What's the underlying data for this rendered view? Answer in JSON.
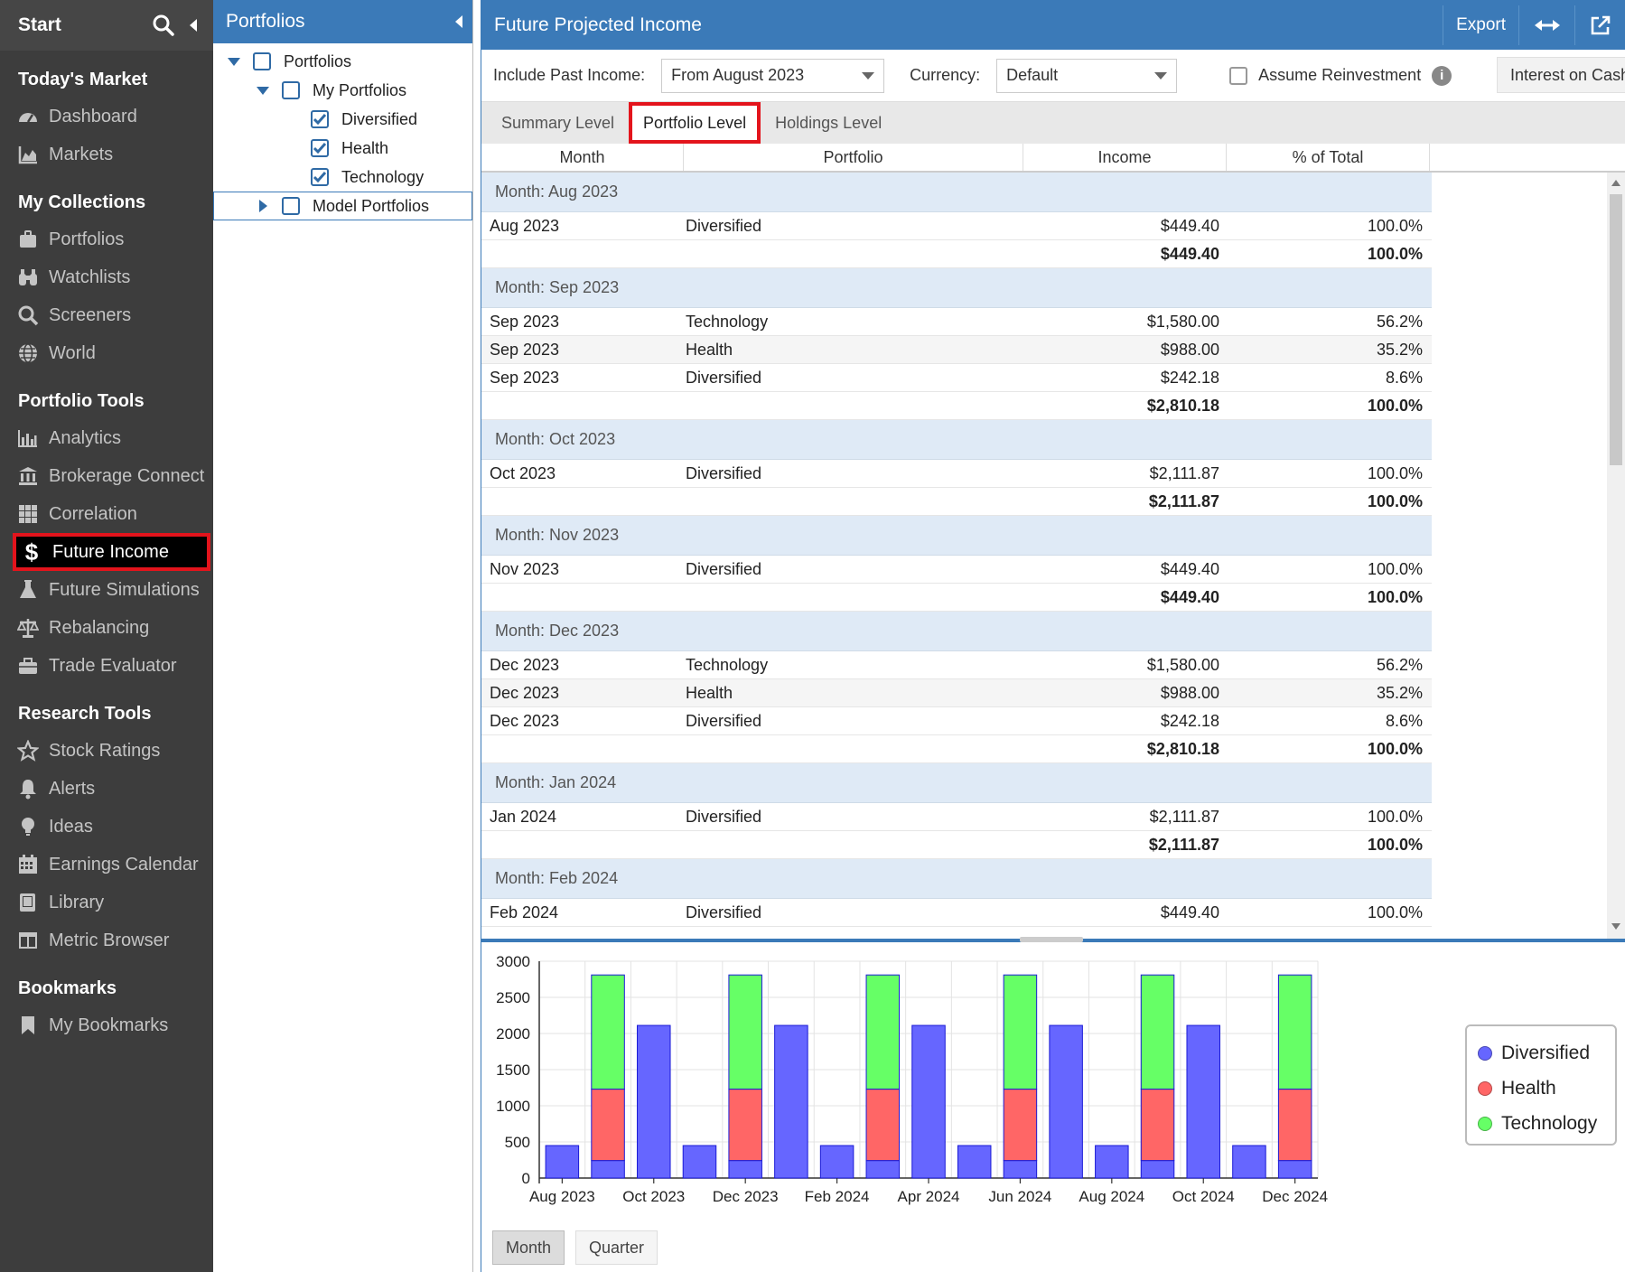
{
  "nav": {
    "start_label": "Start",
    "sections": [
      {
        "title": "Today's Market",
        "items": [
          {
            "label": "Dashboard",
            "icon": "dashboard-icon"
          },
          {
            "label": "Markets",
            "icon": "area-chart-icon"
          }
        ]
      },
      {
        "title": "My Collections",
        "items": [
          {
            "label": "Portfolios",
            "icon": "briefcase-icon"
          },
          {
            "label": "Watchlists",
            "icon": "binoculars-icon"
          },
          {
            "label": "Screeners",
            "icon": "search-icon"
          },
          {
            "label": "World",
            "icon": "globe-icon"
          }
        ]
      },
      {
        "title": "Portfolio Tools",
        "items": [
          {
            "label": "Analytics",
            "icon": "bar-chart-icon"
          },
          {
            "label": "Brokerage Connect",
            "icon": "bank-icon"
          },
          {
            "label": "Correlation",
            "icon": "grid-icon"
          },
          {
            "label": "Future Income",
            "icon": "dollar-icon",
            "active": true
          },
          {
            "label": "Future Simulations",
            "icon": "flask-icon"
          },
          {
            "label": "Rebalancing",
            "icon": "scale-icon"
          },
          {
            "label": "Trade Evaluator",
            "icon": "toolbox-icon"
          }
        ]
      },
      {
        "title": "Research Tools",
        "items": [
          {
            "label": "Stock Ratings",
            "icon": "star-icon"
          },
          {
            "label": "Alerts",
            "icon": "bell-icon"
          },
          {
            "label": "Ideas",
            "icon": "lightbulb-icon"
          },
          {
            "label": "Earnings Calendar",
            "icon": "calendar-icon"
          },
          {
            "label": "Library",
            "icon": "book-icon"
          },
          {
            "label": "Metric Browser",
            "icon": "table-icon"
          }
        ]
      },
      {
        "title": "Bookmarks",
        "items": [
          {
            "label": "My Bookmarks",
            "icon": "bookmark-icon"
          }
        ]
      }
    ]
  },
  "tree": {
    "title": "Portfolios",
    "rows": [
      {
        "label": "Portfolios",
        "level": 0,
        "toggle": "expanded",
        "checked": false
      },
      {
        "label": "My Portfolios",
        "level": 1,
        "toggle": "expanded",
        "checked": false
      },
      {
        "label": "Diversified",
        "level": 2,
        "toggle": "none",
        "checked": true
      },
      {
        "label": "Health",
        "level": 2,
        "toggle": "none",
        "checked": true
      },
      {
        "label": "Technology",
        "level": 2,
        "toggle": "none",
        "checked": true
      },
      {
        "label": "Model Portfolios",
        "level": 1,
        "toggle": "collapsed",
        "checked": false,
        "selected": true
      }
    ]
  },
  "main": {
    "title": "Future Projected Income",
    "export_label": "Export",
    "past_income_label": "Include Past Income:",
    "past_income_value": "From August 2023",
    "currency_label": "Currency:",
    "currency_value": "Default",
    "reinvest_label": "Assume Reinvestment",
    "interest_label": "Interest on Cash",
    "tabs": [
      "Summary Level",
      "Portfolio Level",
      "Holdings Level"
    ],
    "active_tab": 1,
    "columns": [
      "Month",
      "Portfolio",
      "Income",
      "% of Total"
    ],
    "groups": [
      {
        "header": "Month: Aug 2023",
        "rows": [
          [
            "Aug 2023",
            "Diversified",
            "$449.40",
            "100.0%"
          ]
        ],
        "total": [
          "$449.40",
          "100.0%"
        ]
      },
      {
        "header": "Month: Sep 2023",
        "rows": [
          [
            "Sep 2023",
            "Technology",
            "$1,580.00",
            "56.2%"
          ],
          [
            "Sep 2023",
            "Health",
            "$988.00",
            "35.2%"
          ],
          [
            "Sep 2023",
            "Diversified",
            "$242.18",
            "8.6%"
          ]
        ],
        "total": [
          "$2,810.18",
          "100.0%"
        ]
      },
      {
        "header": "Month: Oct 2023",
        "rows": [
          [
            "Oct 2023",
            "Diversified",
            "$2,111.87",
            "100.0%"
          ]
        ],
        "total": [
          "$2,111.87",
          "100.0%"
        ]
      },
      {
        "header": "Month: Nov 2023",
        "rows": [
          [
            "Nov 2023",
            "Diversified",
            "$449.40",
            "100.0%"
          ]
        ],
        "total": [
          "$449.40",
          "100.0%"
        ]
      },
      {
        "header": "Month: Dec 2023",
        "rows": [
          [
            "Dec 2023",
            "Technology",
            "$1,580.00",
            "56.2%"
          ],
          [
            "Dec 2023",
            "Health",
            "$988.00",
            "35.2%"
          ],
          [
            "Dec 2023",
            "Diversified",
            "$242.18",
            "8.6%"
          ]
        ],
        "total": [
          "$2,810.18",
          "100.0%"
        ]
      },
      {
        "header": "Month: Jan 2024",
        "rows": [
          [
            "Jan 2024",
            "Diversified",
            "$2,111.87",
            "100.0%"
          ]
        ],
        "total": [
          "$2,111.87",
          "100.0%"
        ]
      },
      {
        "header": "Month: Feb 2024",
        "rows": [
          [
            "Feb 2024",
            "Diversified",
            "$449.40",
            "100.0%"
          ]
        ],
        "total": null
      }
    ],
    "period_buttons": [
      "Month",
      "Quarter"
    ],
    "active_period": 0
  },
  "colors": {
    "Diversified": "#6666ff",
    "Health": "#ff6666",
    "Technology": "#66ff66"
  },
  "chart_data": {
    "type": "bar",
    "stacked": true,
    "categories": [
      "Aug 2023",
      "Sep 2023",
      "Oct 2023",
      "Nov 2023",
      "Dec 2023",
      "Jan 2024",
      "Feb 2024",
      "Mar 2024",
      "Apr 2024",
      "May 2024",
      "Jun 2024",
      "Jul 2024",
      "Aug 2024",
      "Sep 2024",
      "Oct 2024",
      "Nov 2024",
      "Dec 2024"
    ],
    "tick_labels": [
      "Aug 2023",
      "Oct 2023",
      "Dec 2023",
      "Feb 2024",
      "Apr 2024",
      "Jun 2024",
      "Aug 2024",
      "Oct 2024",
      "Dec 2024"
    ],
    "series": [
      {
        "name": "Diversified",
        "values": [
          449.4,
          242.18,
          2111.87,
          449.4,
          242.18,
          2111.87,
          449.4,
          242.18,
          2111.87,
          449.4,
          242.18,
          2111.87,
          449.4,
          242.18,
          2111.87,
          449.4,
          242.18
        ]
      },
      {
        "name": "Health",
        "values": [
          0,
          988,
          0,
          0,
          988,
          0,
          0,
          988,
          0,
          0,
          988,
          0,
          0,
          988,
          0,
          0,
          988
        ]
      },
      {
        "name": "Technology",
        "values": [
          0,
          1580,
          0,
          0,
          1580,
          0,
          0,
          1580,
          0,
          0,
          1580,
          0,
          0,
          1580,
          0,
          0,
          1580
        ]
      }
    ],
    "yticks": [
      0,
      500,
      1000,
      1500,
      2000,
      2500,
      3000
    ],
    "ylim": [
      0,
      3000
    ],
    "grid": true,
    "legend": "right"
  }
}
